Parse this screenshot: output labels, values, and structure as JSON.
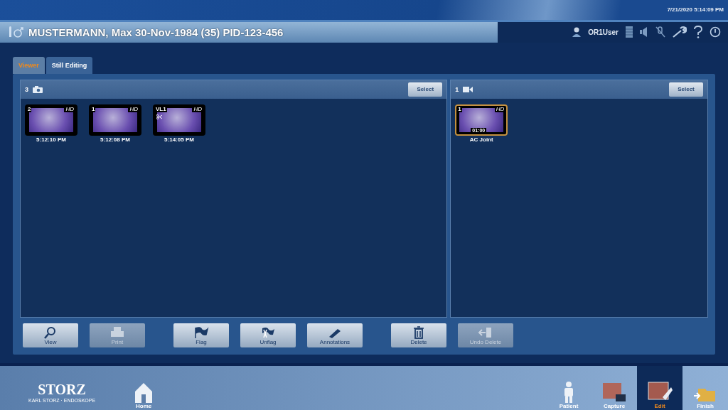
{
  "datetime": "7/21/2020  5:14:09 PM",
  "patient": {
    "text": "MUSTERMANN, Max  30-Nov-1984 (35)  PID-123-456"
  },
  "user": "OR1User",
  "tabs": [
    {
      "label": "Viewer",
      "selected": true
    },
    {
      "label": "Still Editing",
      "selected": false
    }
  ],
  "panels": [
    {
      "kind": "photo",
      "count": "3",
      "select": "Select",
      "items": [
        {
          "index": "2",
          "badge": "HD",
          "edited": false,
          "caption": "5:12:10 PM",
          "selected": false
        },
        {
          "index": "1",
          "badge": "HD",
          "edited": false,
          "caption": "5:12:08 PM",
          "selected": false
        },
        {
          "index": "VL1",
          "badge": "HD",
          "edited": true,
          "caption": "5:14:05 PM",
          "selected": false
        }
      ]
    },
    {
      "kind": "video",
      "count": "1",
      "select": "Select",
      "items": [
        {
          "index": "1",
          "badge": "HD",
          "edited": false,
          "duration": "01:00",
          "caption": "AC Joint",
          "selected": true
        }
      ]
    }
  ],
  "toolbar": [
    [
      {
        "kind": "view",
        "label": "View",
        "disabled": false
      },
      {
        "kind": "print",
        "label": "Print",
        "disabled": true
      }
    ],
    [
      {
        "kind": "flag",
        "label": "Flag",
        "disabled": false
      },
      {
        "kind": "unflag",
        "label": "Unflag",
        "disabled": false
      },
      {
        "kind": "annotate",
        "label": "Annotations",
        "disabled": false
      }
    ],
    [
      {
        "kind": "delete",
        "label": "Delete",
        "disabled": false
      },
      {
        "kind": "undo",
        "label": "Undo Delete",
        "disabled": true
      }
    ]
  ],
  "logo": {
    "brand": "STORZ",
    "sub": "KARL STORZ · ENDOSKOPE"
  },
  "nav": [
    {
      "kind": "home",
      "label": "Home",
      "selected": false
    },
    {
      "kind": "patient",
      "label": "Patient",
      "selected": false
    },
    {
      "kind": "capture",
      "label": "Capture",
      "selected": false
    },
    {
      "kind": "edit",
      "label": "Edit",
      "selected": true
    },
    {
      "kind": "finish",
      "label": "Finish",
      "selected": false
    }
  ]
}
